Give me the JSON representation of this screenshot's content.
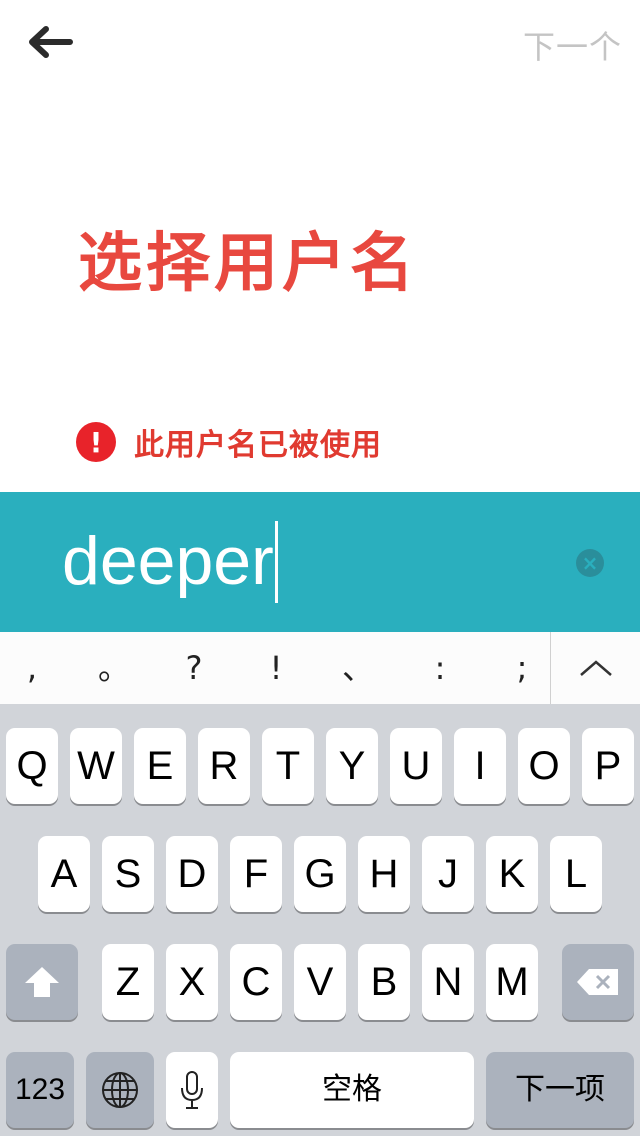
{
  "nav": {
    "next_label": "下一个"
  },
  "title": "选择用户名",
  "error": {
    "icon_text": "!",
    "message": "此用户名已被使用"
  },
  "input": {
    "value": "deeper"
  },
  "punctuation": [
    ",",
    "。",
    "?",
    "!",
    "、",
    ":",
    ";"
  ],
  "keyboard": {
    "row1": [
      "Q",
      "W",
      "E",
      "R",
      "T",
      "Y",
      "U",
      "I",
      "O",
      "P"
    ],
    "row2": [
      "A",
      "S",
      "D",
      "F",
      "G",
      "H",
      "J",
      "K",
      "L"
    ],
    "row3": [
      "Z",
      "X",
      "C",
      "V",
      "B",
      "N",
      "M"
    ],
    "numbers_label": "123",
    "space_label": "空格",
    "next_label": "下一项"
  },
  "colors": {
    "accent_red": "#e8483f",
    "input_bar": "#2aafbe",
    "keyboard_bg": "#d1d4d9"
  },
  "icons": [
    "back-arrow-icon",
    "error-icon",
    "clear-icon",
    "chevron-up-icon",
    "shift-icon",
    "backspace-icon",
    "globe-icon",
    "microphone-icon"
  ]
}
